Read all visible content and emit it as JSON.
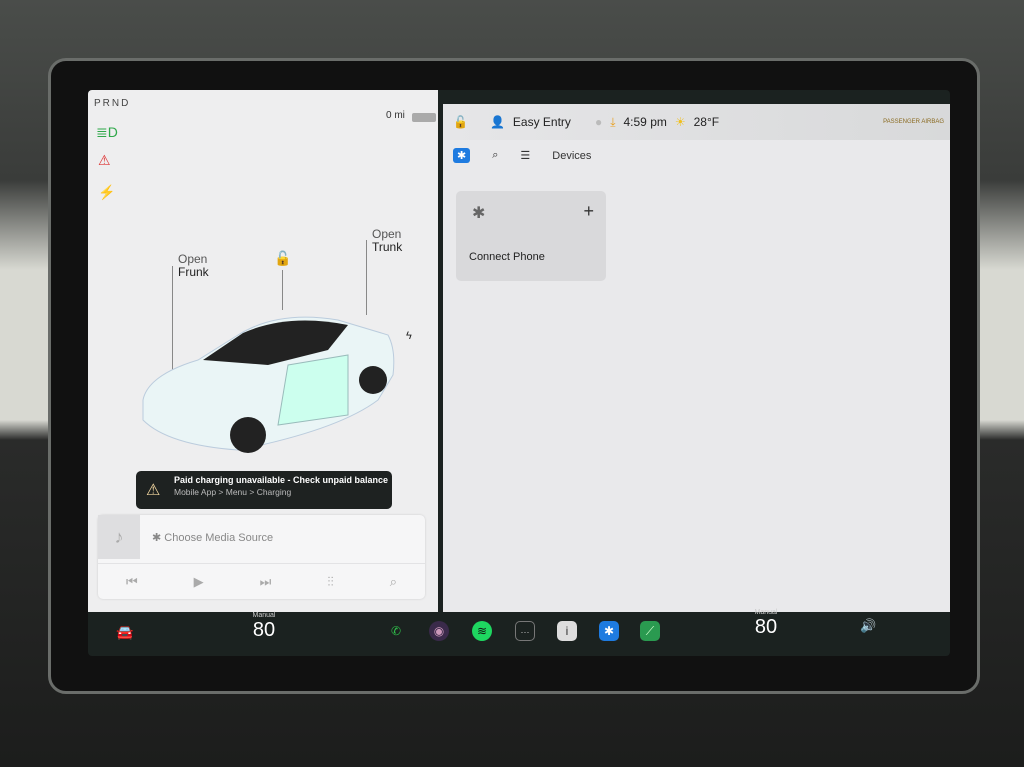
{
  "status": {
    "gear": "PRND",
    "odometer": "0 mi",
    "profile": "Easy Entry",
    "time": "4:59 pm",
    "temperature": "28°F",
    "airbag": "PASSENGER AIRBAG"
  },
  "car": {
    "frunk_action": "Open",
    "frunk_label": "Frunk",
    "trunk_action": "Open",
    "trunk_label": "Trunk"
  },
  "alert": {
    "title": "Paid charging unavailable - Check unpaid balance",
    "subtitle": "Mobile App > Menu > Charging"
  },
  "media": {
    "source": "Choose Media Source"
  },
  "bluetooth": {
    "tab_devices": "Devices",
    "connect_phone": "Connect Phone"
  },
  "dock": {
    "driver_temp_mode": "Manual",
    "driver_temp": "80",
    "passenger_temp_mode": "Manual",
    "passenger_temp": "80"
  },
  "colors": {
    "bluetooth": "#1e7be0",
    "phone": "#2fbf4a",
    "spotify": "#1ed760",
    "screen_bg": "#eeeeef"
  }
}
